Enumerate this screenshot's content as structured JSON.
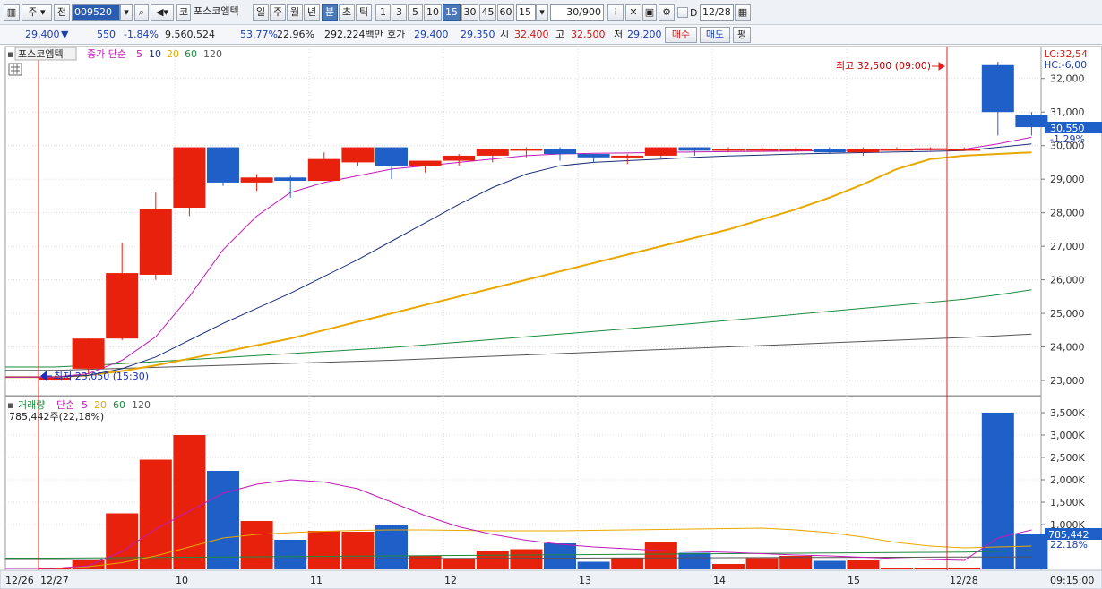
{
  "toolbar": {
    "market_label": "주",
    "prev_label": "전",
    "code": "009520",
    "stock_name": "포스코엠텍",
    "period_buttons": [
      "일",
      "주",
      "월",
      "년",
      "분",
      "초",
      "틱"
    ],
    "selected_period": "분",
    "interval_buttons": [
      "1",
      "3",
      "5",
      "10",
      "15",
      "30",
      "45",
      "60"
    ],
    "selected_interval": "15",
    "interval_value": "15",
    "count_value": "30/900",
    "date_value": "12/28",
    "date_checkbox_label": "D",
    "code_prefix": "코"
  },
  "quote": {
    "price": "29,400",
    "change_arrow": "▼",
    "change": "550",
    "change_pct": "-1.84%",
    "volume": "9,560,524",
    "volume_pct": "53.77%",
    "turnover_pct": "22.96%",
    "amount": "292,224백만",
    "ask_label": "호가",
    "ask": "29,400",
    "bid": "29,350",
    "open_label": "시",
    "open": "32,400",
    "high_label": "고",
    "high": "32,500",
    "low_label": "저",
    "low": "29,200",
    "buy_button": "매수",
    "sell_button": "매도",
    "eval_button": "평"
  },
  "price_panel": {
    "name_tag": "포스코엠텍",
    "legend_label": "종가 단순",
    "ma_periods": [
      "5",
      "10",
      "20",
      "60",
      "120"
    ],
    "ma_colors": [
      "#c21ab8",
      "#1a2f7a",
      "#e8a800",
      "#1e8a3c",
      "#555555"
    ],
    "high_marker": "최고 32,500 (09:00)",
    "low_marker": "최저 23,050 (15:30)",
    "lc_label": "LC:32,54",
    "hc_label": "HC:-6,00",
    "current_price": "30,550",
    "current_pct": "-1.29%",
    "y_ticks": [
      "32,000",
      "31,000",
      "30,000",
      "29,000",
      "28,000",
      "27,000",
      "26,000",
      "25,000",
      "24,000",
      "23,000"
    ]
  },
  "volume_panel": {
    "legend_label": "거래량",
    "legend_ma": "단순",
    "ma_periods": [
      "5",
      "20",
      "60",
      "120"
    ],
    "current_volume": "785,442주(22,18%)",
    "current_tag": "785,442",
    "current_pct": "22.18%",
    "y_ticks": [
      "3,500K",
      "3,000K",
      "2,500K",
      "2,000K",
      "1,500K",
      "1,000K"
    ]
  },
  "x_axis": {
    "labels": [
      "12/26",
      "12/27",
      "10",
      "11",
      "12",
      "13",
      "14",
      "15",
      "12/28"
    ],
    "time_label": "09:15:00"
  },
  "colors": {
    "up": "#e8210c",
    "down": "#1f5fc8",
    "grid": "#dcdcdc",
    "ma5": "#c21ab8",
    "ma10": "#1a2f7a",
    "ma20": "#e8a800",
    "ma60": "#1e8a3c",
    "ma120": "#555555"
  },
  "chart_data": {
    "type": "candlestick",
    "price_ylim": [
      22600,
      32900
    ],
    "volume_ylim": [
      0,
      3800000
    ],
    "candles": [
      {
        "o": 23050,
        "h": 23100,
        "l": 23000,
        "c": 23080,
        "v": 20000
      },
      {
        "o": 23350,
        "h": 24250,
        "l": 23200,
        "c": 24250,
        "v": 200000
      },
      {
        "o": 24250,
        "h": 27100,
        "l": 24200,
        "c": 26200,
        "v": 1250000
      },
      {
        "o": 26150,
        "h": 28600,
        "l": 26000,
        "c": 28100,
        "v": 2450000
      },
      {
        "o": 28150,
        "h": 29950,
        "l": 27900,
        "c": 29950,
        "v": 3000000
      },
      {
        "o": 29950,
        "h": 29950,
        "l": 28800,
        "c": 28900,
        "v": 2200000
      },
      {
        "o": 28900,
        "h": 29150,
        "l": 28650,
        "c": 29050,
        "v": 1080000
      },
      {
        "o": 29050,
        "h": 29100,
        "l": 28450,
        "c": 28950,
        "v": 660000
      },
      {
        "o": 28950,
        "h": 29800,
        "l": 28950,
        "c": 29600,
        "v": 860000
      },
      {
        "o": 29500,
        "h": 29950,
        "l": 29400,
        "c": 29950,
        "v": 840000
      },
      {
        "o": 29950,
        "h": 29950,
        "l": 29000,
        "c": 29400,
        "v": 1000000
      },
      {
        "o": 29400,
        "h": 29550,
        "l": 29200,
        "c": 29550,
        "v": 300000
      },
      {
        "o": 29550,
        "h": 29750,
        "l": 29400,
        "c": 29700,
        "v": 250000
      },
      {
        "o": 29700,
        "h": 29900,
        "l": 29500,
        "c": 29900,
        "v": 420000
      },
      {
        "o": 29850,
        "h": 29950,
        "l": 29650,
        "c": 29900,
        "v": 450000
      },
      {
        "o": 29900,
        "h": 29950,
        "l": 29550,
        "c": 29750,
        "v": 580000
      },
      {
        "o": 29750,
        "h": 29750,
        "l": 29500,
        "c": 29650,
        "v": 170000
      },
      {
        "o": 29650,
        "h": 29750,
        "l": 29450,
        "c": 29700,
        "v": 250000
      },
      {
        "o": 29700,
        "h": 29950,
        "l": 29650,
        "c": 29950,
        "v": 600000
      },
      {
        "o": 29950,
        "h": 29950,
        "l": 29700,
        "c": 29850,
        "v": 370000
      },
      {
        "o": 29850,
        "h": 29950,
        "l": 29800,
        "c": 29900,
        "v": 120000
      },
      {
        "o": 29850,
        "h": 29950,
        "l": 29800,
        "c": 29900,
        "v": 250000
      },
      {
        "o": 29900,
        "h": 29950,
        "l": 29800,
        "c": 29900,
        "v": 300000
      },
      {
        "o": 29900,
        "h": 29950,
        "l": 29750,
        "c": 29800,
        "v": 190000
      },
      {
        "o": 29800,
        "h": 29950,
        "l": 29700,
        "c": 29900,
        "v": 200000
      },
      {
        "o": 29900,
        "h": 29950,
        "l": 29850,
        "c": 29900,
        "v": 20000
      },
      {
        "o": 29900,
        "h": 29950,
        "l": 29850,
        "c": 29920,
        "v": 30000
      },
      {
        "o": 29900,
        "h": 29950,
        "l": 29850,
        "c": 29900,
        "v": 30000
      },
      {
        "o": 32400,
        "h": 32500,
        "l": 30300,
        "c": 31000,
        "v": 3500000
      },
      {
        "o": 30900,
        "h": 31000,
        "l": 30300,
        "c": 30550,
        "v": 785442
      }
    ],
    "ma5": [
      23100,
      23200,
      23600,
      24300,
      25500,
      26900,
      27900,
      28600,
      28900,
      29100,
      29300,
      29400,
      29500,
      29600,
      29700,
      29750,
      29770,
      29780,
      29800,
      29810,
      29820,
      29830,
      29840,
      29850,
      29860,
      29870,
      29880,
      29890,
      30050,
      30250
    ],
    "ma10": [
      23100,
      23150,
      23350,
      23700,
      24200,
      24700,
      25150,
      25600,
      26100,
      26600,
      27150,
      27700,
      28250,
      28750,
      29150,
      29400,
      29500,
      29550,
      29600,
      29650,
      29690,
      29720,
      29750,
      29770,
      29790,
      29810,
      29830,
      29850,
      29950,
      30050
    ],
    "ma20": [
      23100,
      23150,
      23280,
      23450,
      23650,
      23850,
      24050,
      24250,
      24500,
      24750,
      25000,
      25250,
      25500,
      25750,
      26000,
      26250,
      26500,
      26750,
      27000,
      27250,
      27500,
      27800,
      28100,
      28450,
      28850,
      29300,
      29600,
      29700,
      29750,
      29800
    ],
    "ma60": [
      23400,
      23450,
      23500,
      23560,
      23620,
      23680,
      23740,
      23800,
      23860,
      23920,
      23980,
      24060,
      24140,
      24220,
      24300,
      24380,
      24460,
      24540,
      24620,
      24700,
      24790,
      24880,
      24970,
      25060,
      25150,
      25240,
      25330,
      25420,
      25550,
      25700
    ],
    "ma120": [
      23300,
      23330,
      23360,
      23390,
      23420,
      23450,
      23480,
      23510,
      23540,
      23570,
      23600,
      23640,
      23680,
      23720,
      23760,
      23800,
      23840,
      23880,
      23920,
      23960,
      24000,
      24040,
      24080,
      24120,
      24160,
      24200,
      24240,
      24280,
      24330,
      24380
    ],
    "vol_ma5": [
      20000,
      80000,
      400000,
      900000,
      1300000,
      1700000,
      1900000,
      2000000,
      1950000,
      1800000,
      1500000,
      1200000,
      950000,
      780000,
      650000,
      560000,
      500000,
      460000,
      420000,
      400000,
      380000,
      350000,
      320000,
      300000,
      270000,
      240000,
      220000,
      200000,
      700000,
      880000
    ],
    "vol_ma20": [
      20000,
      60000,
      150000,
      300000,
      500000,
      700000,
      780000,
      820000,
      850000,
      870000,
      880000,
      880000,
      870000,
      860000,
      860000,
      860000,
      870000,
      880000,
      890000,
      900000,
      910000,
      920000,
      880000,
      820000,
      720000,
      600000,
      520000,
      480000,
      500000,
      520000
    ],
    "vol_ma60": [
      250000,
      255000,
      260000,
      265000,
      270000,
      275000,
      280000,
      285000,
      290000,
      295000,
      300000,
      305000,
      310000,
      315000,
      320000,
      325000,
      330000,
      335000,
      340000,
      345000,
      350000,
      355000,
      360000,
      365000,
      370000,
      375000,
      380000,
      385000,
      400000,
      420000
    ],
    "vol_ma120": [
      220000,
      222000,
      224000,
      226000,
      228000,
      230000,
      232000,
      234000,
      236000,
      238000,
      240000,
      242000,
      244000,
      246000,
      248000,
      250000,
      252000,
      254000,
      256000,
      258000,
      260000,
      262000,
      264000,
      266000,
      268000,
      270000,
      272000,
      274000,
      276000,
      278000
    ]
  }
}
